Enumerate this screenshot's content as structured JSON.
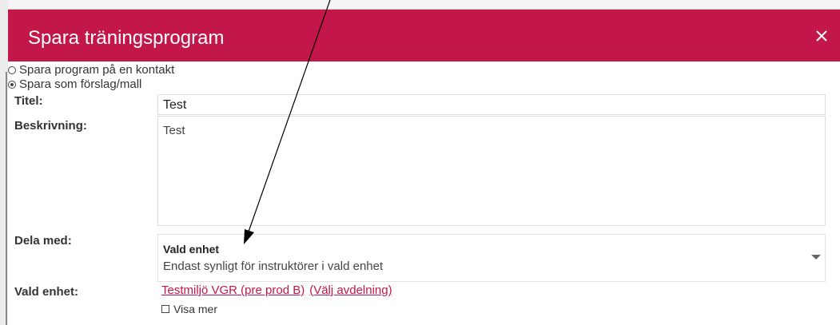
{
  "dialog": {
    "title": "Spara träningsprogram",
    "close_icon": "close-icon",
    "header_color": "#c3174a"
  },
  "save_options": [
    {
      "label": "Spara program på en kontakt",
      "checked": false
    },
    {
      "label": "Spara som förslag/mall",
      "checked": true
    }
  ],
  "form": {
    "title_label": "Titel:",
    "title_value": "Test",
    "description_label": "Beskrivning:",
    "description_value": "Test",
    "share_label": "Dela med:",
    "share_selected": "Vald enhet",
    "share_selected_desc": "Endast synligt för instruktörer i vald enhet",
    "unit_label": "Vald enhet:",
    "unit_link": "Testmiljö VGR (pre prod B)",
    "unit_change_link": "(Välj avdelning)",
    "show_more_label": "Visa mer"
  },
  "annotation": {
    "arrow_icon": "annotation-arrow-icon"
  }
}
